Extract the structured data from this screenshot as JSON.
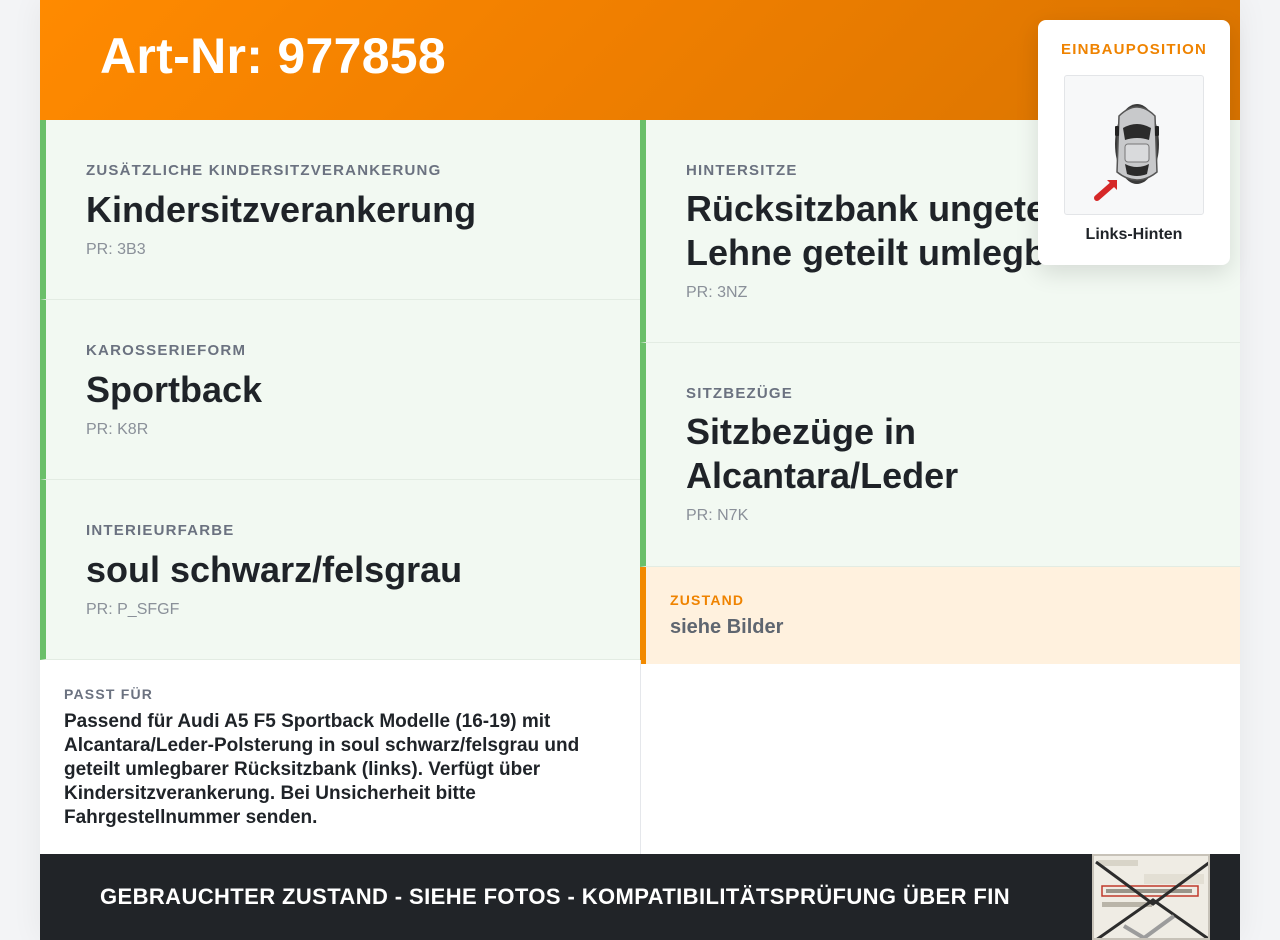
{
  "header": {
    "title": "Art-Nr: 977858"
  },
  "attributes": [
    {
      "label": "Zusätzliche Kindersitzverankerung",
      "value": "Kindersitzverankerung",
      "pr": "PR: 3B3"
    },
    {
      "label": "Karosserieform",
      "value": "Sportback",
      "pr": "PR: K8R"
    },
    {
      "label": "Interieurfarbe",
      "value": "soul schwarz/felsgrau",
      "pr": "PR: P_SFGF"
    },
    {
      "label": "Hintersitze",
      "value": "Rücksitzbank ungeteilt, Lehne geteilt umlegbar",
      "value_line1": "Rücksitzbank ungete",
      "value_line2": "Lehne geteilt umlegb",
      "pr": "PR: 3NZ"
    },
    {
      "label": "Sitzbezüge",
      "value_line1": "Sitzbezüge in",
      "value_line2": "Alcantara/Leder",
      "pr": "PR: N7K"
    }
  ],
  "zustand": {
    "label": "Zustand",
    "value": "siehe Bilder"
  },
  "passt_fuer": {
    "label": "Passt für",
    "text": "Passend für Audi A5 F5 Sportback Modelle (16-19) mit Alcantara/Leder-Polsterung in soul schwarz/felsgrau und geteilt umlegbarer Rücksitzbank (links). Verfügt über Kindersitzverankerung. Bei Unsicherheit bitte Fahrgestellnummer senden."
  },
  "footer": {
    "text": "GEBRAUCHTER ZUSTAND - SIEHE FOTOS - KOMPATIBILITÄTSPRÜFUNG ÜBER FIN"
  },
  "einbau": {
    "title": "EINBAUPOSITION",
    "position": "Links-Hinten"
  },
  "colors": {
    "accent": "#f28a00",
    "green": "#6abf69",
    "dark": "#212428"
  }
}
